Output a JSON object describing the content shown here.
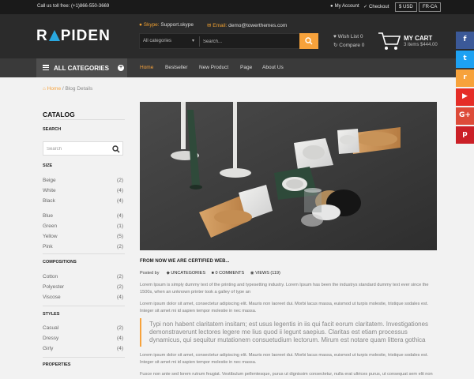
{
  "topbar": {
    "phone": "Call us toll free: (+1)866-550-3669",
    "account": "My Account",
    "checkout": "Checkout",
    "currency": "$ USD",
    "language": "FR-CA"
  },
  "header": {
    "logo_text_before": "R",
    "logo_text_after": "PIDEN",
    "skype_label": "Skype:",
    "skype_value": "Support.skype",
    "email_label": "Email:",
    "email_value": "demo@towerthemes.com",
    "search_category": "All categories",
    "search_placeholder": "Search...",
    "wishlist": "Wish List 0",
    "compare": "Compare 0",
    "cart_title": "MY CART",
    "cart_summary": "3 items $444.00"
  },
  "nav": {
    "all_categories": "ALL CATEGORIES",
    "items": [
      "Home",
      "Bestseller",
      "New Product",
      "Page",
      "About Us"
    ],
    "active": "Home"
  },
  "social": [
    {
      "icon": "facebook-icon",
      "glyph": "f",
      "color": "#3b5998"
    },
    {
      "icon": "twitter-icon",
      "glyph": "t",
      "color": "#1da1f2"
    },
    {
      "icon": "rss-icon",
      "glyph": "r",
      "color": "#f7a23b"
    },
    {
      "icon": "youtube-icon",
      "glyph": "▶",
      "color": "#e52d27"
    },
    {
      "icon": "google-plus-icon",
      "glyph": "G+",
      "color": "#dd4b39"
    },
    {
      "icon": "pinterest-icon",
      "glyph": "p",
      "color": "#cb2027"
    }
  ],
  "breadcrumb": {
    "home": "Home",
    "current": "Blog Details"
  },
  "sidebar": {
    "title": "CATALOG",
    "search_heading": "SEARCH",
    "search_placeholder": "Search",
    "size_heading": "SIZE",
    "size_items": [
      {
        "label": "Beige",
        "count": "(2)"
      },
      {
        "label": "White",
        "count": "(4)"
      },
      {
        "label": "Black",
        "count": "(4)"
      },
      {
        "label": "Blue",
        "count": "(4)"
      },
      {
        "label": "Green",
        "count": "(1)"
      },
      {
        "label": "Yellow",
        "count": "(5)"
      },
      {
        "label": "Pink",
        "count": "(2)"
      }
    ],
    "compositions_heading": "COMPOSITIONS",
    "compositions_items": [
      {
        "label": "Cotton",
        "count": "(2)"
      },
      {
        "label": "Polyester",
        "count": "(2)"
      },
      {
        "label": "Viscose",
        "count": "(4)"
      }
    ],
    "styles_heading": "STYLES",
    "styles_items": [
      {
        "label": "Casual",
        "count": "(2)"
      },
      {
        "label": "Dressy",
        "count": "(4)"
      },
      {
        "label": "Girly",
        "count": "(4)"
      }
    ],
    "properties_heading": "PROPERTIES"
  },
  "post": {
    "title": "FROM NOW WE ARE CERTIFIED WEB...",
    "posted_by": "Posted by",
    "category": "UNCATEGORIES",
    "comments": "0 COMMENTS",
    "views": "VIEWS (119)",
    "para1": "Lorem Ipsum is simply dummy text of the printing and typesetting industry. Lorem Ipsum has been the industrys standard dummy text ever since the 1500s, when an unknown printer took a galley of type an",
    "para2": "Lorem ipsum dolor sit amet, consectetur adipiscing elit. Mauris non laoreet dui. Morbi lacus massa, euismod ut turpis molestie, tristique sodales est. Integer sit amet mi id sapien tempor molestie in nec massa.",
    "quote": "Typi non habent claritatem insitam; est usus legentis in iis qui facit eorum claritatem. Investigationes demonstraverunt lectores legere me lius quod ii legunt saepius. Claritas est etiam processus dynamicus, qui sequitur mutationem consuetudium lectorum. Mirum est notare quam littera gothica",
    "para3": "Lorem ipsum dolor sit amet, consectetur adipiscing elit. Mauris non laoreet dui. Morbi lacus massa, euismod ut turpis molestie, tristique sodales est. Integer sit amet mi id sapien tempor molestie in nec massa.",
    "para4": "Fusce non ante sed lorem rutrum feugiat. Vestibulum pellentesque, purus ut dignissim consectetur, nulla erat ultrices purus, ut consequat sem elit non"
  },
  "colors": {
    "accent": "#f7a23b",
    "logo_blue": "#29a8e0",
    "header_bg": "#2b2b2b"
  }
}
